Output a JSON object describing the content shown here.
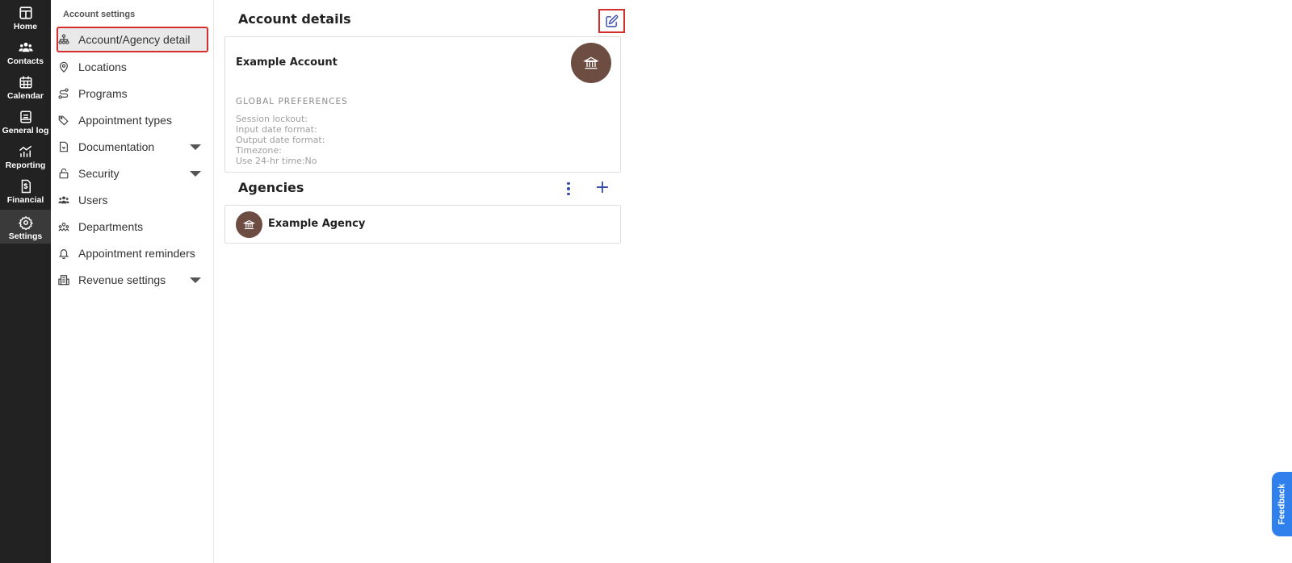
{
  "rail": {
    "items": [
      {
        "label": "Home",
        "icon": "home-icon"
      },
      {
        "label": "Contacts",
        "icon": "contacts-icon"
      },
      {
        "label": "Calendar",
        "icon": "calendar-icon"
      },
      {
        "label": "General log",
        "icon": "general-log-icon"
      },
      {
        "label": "Reporting",
        "icon": "reporting-icon"
      },
      {
        "label": "Financial",
        "icon": "financial-icon"
      },
      {
        "label": "Settings",
        "icon": "settings-icon"
      }
    ],
    "active": "Settings"
  },
  "sidebar": {
    "title": "Account settings",
    "items": [
      {
        "label": "Account/Agency detail",
        "icon": "hierarchy-icon"
      },
      {
        "label": "Locations",
        "icon": "location-pin-icon"
      },
      {
        "label": "Programs",
        "icon": "route-icon"
      },
      {
        "label": "Appointment types",
        "icon": "tags-icon"
      },
      {
        "label": "Documentation",
        "icon": "document-icon"
      },
      {
        "label": "Security",
        "icon": "unlock-icon"
      },
      {
        "label": "Users",
        "icon": "users-icon"
      },
      {
        "label": "Departments",
        "icon": "departments-icon"
      },
      {
        "label": "Appointment reminders",
        "icon": "bell-icon"
      },
      {
        "label": "Revenue settings",
        "icon": "building-icon"
      }
    ],
    "active": "Account/Agency detail"
  },
  "account_details": {
    "title": "Account details",
    "account_name": "Example Account",
    "global_preferences_title": "GLOBAL PREFERENCES",
    "preferences": {
      "session_lockout": "Session lockout:",
      "input_date_format": "Input date format:",
      "output_date_format": "Output date format:",
      "timezone": "Timezone:",
      "use_24hr": "Use 24-hr time:No"
    }
  },
  "agencies": {
    "title": "Agencies",
    "items": [
      {
        "name": "Example Agency"
      }
    ]
  },
  "feedback": {
    "label": "Feedback"
  },
  "colors": {
    "rail_bg": "#222222",
    "accent": "#3949ab",
    "avatar_bg": "#6d4c41",
    "highlight": "#d32f2f",
    "feedback": "#2f80ed"
  }
}
